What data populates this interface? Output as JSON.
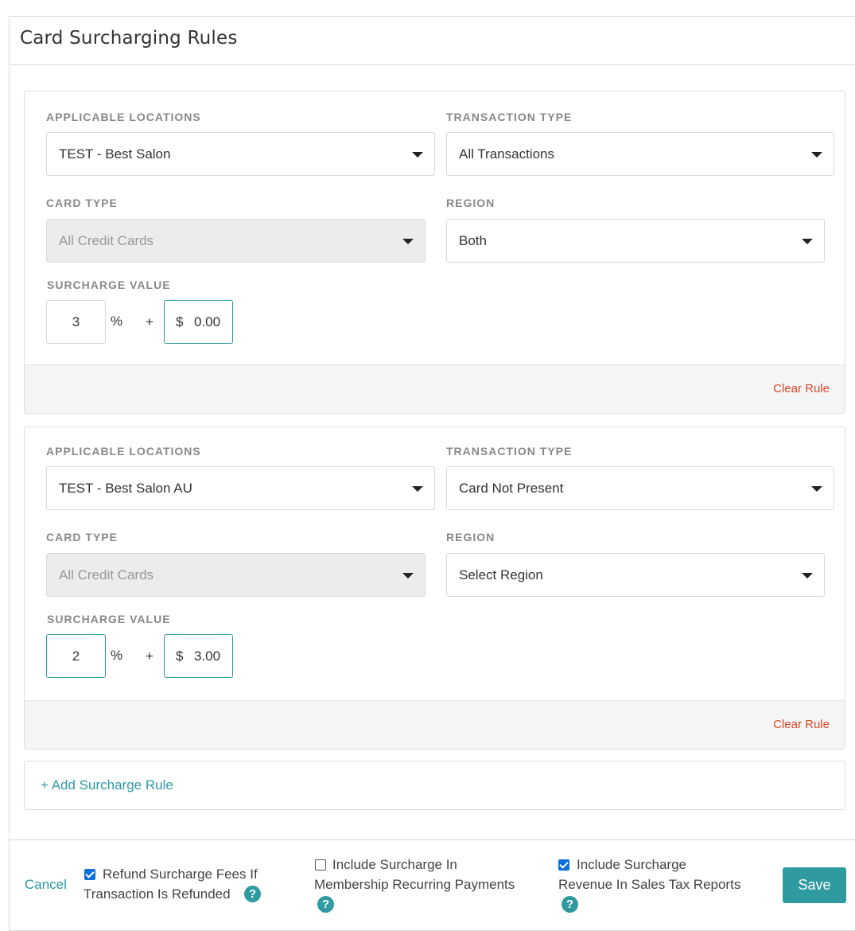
{
  "title": "Card Surcharging Rules",
  "labels": {
    "locations": "APPLICABLE LOCATIONS",
    "transaction_type": "TRANSACTION TYPE",
    "card_type": "CARD TYPE",
    "region": "REGION",
    "surcharge_value": "SURCHARGE VALUE",
    "percent_sign": "%",
    "plus_sign": "+",
    "dollar_sign": "$"
  },
  "rules": [
    {
      "location": "TEST - Best Salon",
      "transaction_type": "All Transactions",
      "card_type": "All Credit Cards",
      "region": "Both",
      "percent": "3",
      "fixed": "0.00",
      "clear_label": "Clear Rule"
    },
    {
      "location": "TEST - Best Salon AU",
      "transaction_type": "Card Not Present",
      "card_type": "All Credit Cards",
      "region": "Select Region",
      "percent": "2",
      "fixed": "3.00",
      "clear_label": "Clear Rule"
    }
  ],
  "add_rule_label": "+ Add Surcharge Rule",
  "footer": {
    "cancel_label": "Cancel",
    "options": [
      {
        "line1": "Refund Surcharge Fees If",
        "line2": "Transaction Is Refunded",
        "checked": true
      },
      {
        "line1": "Include Surcharge In",
        "line2": "Membership Recurring Payments",
        "checked": false
      },
      {
        "line1": "Include Surcharge",
        "line2": "Revenue In Sales Tax Reports",
        "checked": true
      }
    ],
    "help_glyph": "?",
    "save_label": "Save"
  },
  "colors": {
    "accent": "#2f9aa0",
    "danger": "#d9462a",
    "checkbox": "#0a6fd8"
  }
}
